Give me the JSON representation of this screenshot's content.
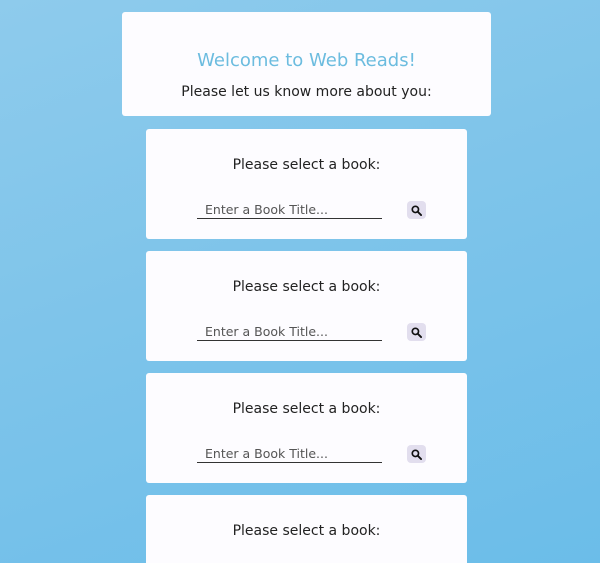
{
  "header": {
    "title": "Welcome to Web Reads!",
    "subtitle": "Please let us know more about you:"
  },
  "book_cards": [
    {
      "prompt": "Please select a book:",
      "input_placeholder": "Enter a Book Title...",
      "search_icon": "search-icon"
    },
    {
      "prompt": "Please select a book:",
      "input_placeholder": "Enter a Book Title...",
      "search_icon": "search-icon"
    },
    {
      "prompt": "Please select a book:",
      "input_placeholder": "Enter a Book Title...",
      "search_icon": "search-icon"
    },
    {
      "prompt": "Please select a book:"
    }
  ],
  "colors": {
    "background": "#7ec4ea",
    "card": "#fdfcff",
    "title": "#6cbcdf",
    "search_button": "#e2deee"
  }
}
